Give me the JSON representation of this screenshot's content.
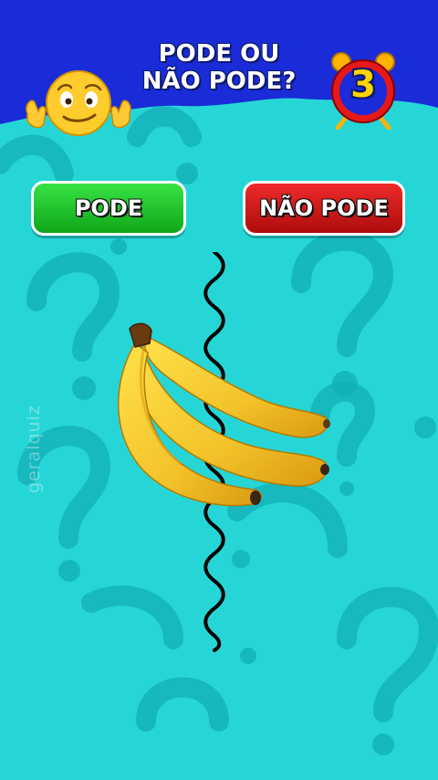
{
  "quiz": {
    "title_line1": "PODE OU",
    "title_line2": "NÃO PODE?",
    "timer_value": "3",
    "watermark": "geralquiz"
  },
  "choices": {
    "left_label": "PODE",
    "right_label": "NÃO PODE"
  },
  "item": {
    "icon": "banana-bunch-image"
  },
  "colors": {
    "background": "#26d6d6",
    "header": "#1a2bd8",
    "pode_button": "#1fc92b",
    "nao_pode_button": "#d41818",
    "timer_ring": "#e61919"
  }
}
